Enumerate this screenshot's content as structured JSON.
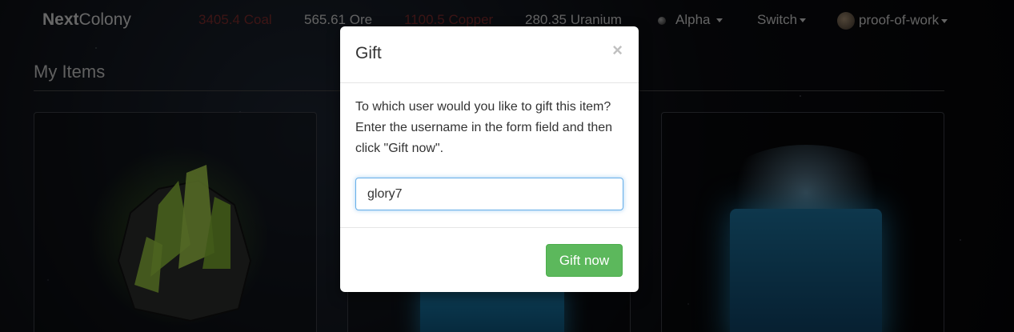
{
  "brand": {
    "bold": "Next",
    "rest": "Colony"
  },
  "resources": {
    "coal": "3405.4 Coal",
    "ore": "565.61 Ore",
    "copper": "1100.5 Copper",
    "uranium": "280.35 Uranium"
  },
  "nav": {
    "alpha": "Alpha",
    "switch": "Switch",
    "user": "proof-of-work"
  },
  "section_title": "My Items",
  "modal": {
    "title": "Gift",
    "close": "×",
    "body": "To which user would you like to gift this item? Enter the username in the form field and then click \"Gift now\".",
    "input_value": "glory7",
    "button": "Gift now"
  },
  "colors": {
    "accent_green": "#5cb85c",
    "resource_red": "#7a2a2a"
  }
}
